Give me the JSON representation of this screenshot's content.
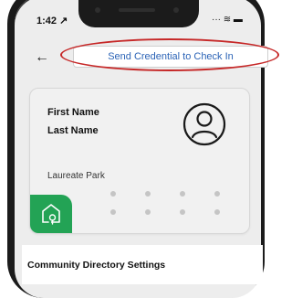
{
  "status": {
    "time": "1:42 ↗",
    "right": "···  ≋ ▬"
  },
  "header": {
    "back_icon": "arrow-left-icon",
    "cta_label": "Send Credential to Check In",
    "highlight_color": "#c62828",
    "cta_text_color": "#2b63b6"
  },
  "card": {
    "first_name": "First Name",
    "last_name": "Last Name",
    "community": "Laureate Park",
    "avatar_icon": "user-circle-icon",
    "badge_icon": "home-location-icon",
    "badge_color": "#23a355"
  },
  "settings": {
    "title": "Community Directory Settings"
  }
}
